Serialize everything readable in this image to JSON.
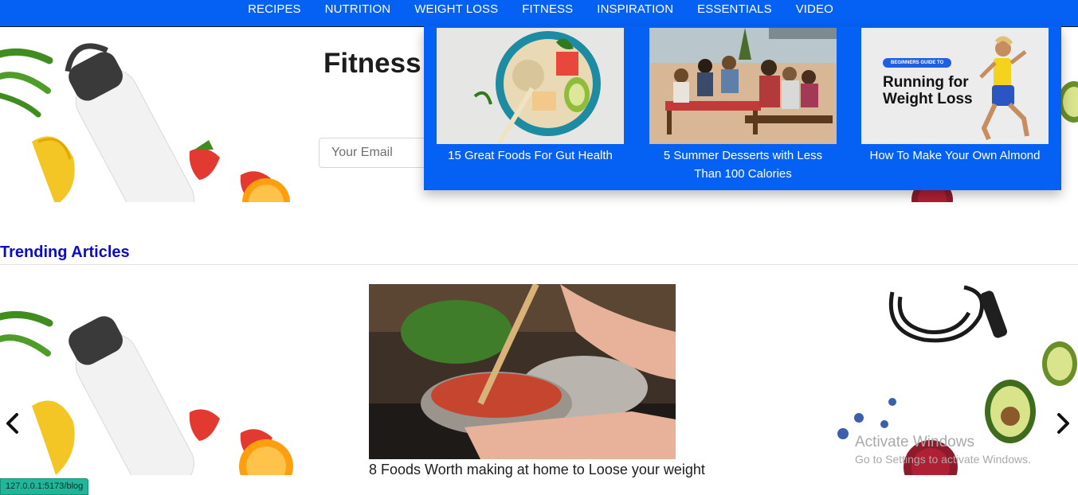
{
  "nav": {
    "items": [
      "RECIPES",
      "NUTRITION",
      "WEIGHT LOSS",
      "FITNESS",
      "INSPIRATION",
      "ESSENTIALS",
      "VIDEO"
    ]
  },
  "hero": {
    "title": "Fitness",
    "email_placeholder": "Your Email"
  },
  "mega_menu": {
    "cards": [
      {
        "caption": "15 Great Foods For Gut Health",
        "image": "salad-bowl-image"
      },
      {
        "caption": "5 Summer Desserts with Less Than 100 Calories",
        "image": "beach-picnic-image"
      },
      {
        "caption": "How To Make Your Own Almond",
        "image": "running-weight-loss-image",
        "badge": "BEGINNERS GUIDE TO",
        "headline": "Running for Weight Loss"
      }
    ]
  },
  "trending": {
    "title": "Trending Articles",
    "center_caption": "8 Foods Worth making at home to Loose your weight"
  },
  "watermark": {
    "line1": "Activate Windows",
    "line2": "Go to Settings to activate Windows."
  },
  "status_url": "127.0.0.1:5173/blog",
  "colors": {
    "nav_bg": "#0561f4",
    "heading_blue": "#0b0bd0",
    "status_bg": "#1fb69a"
  }
}
